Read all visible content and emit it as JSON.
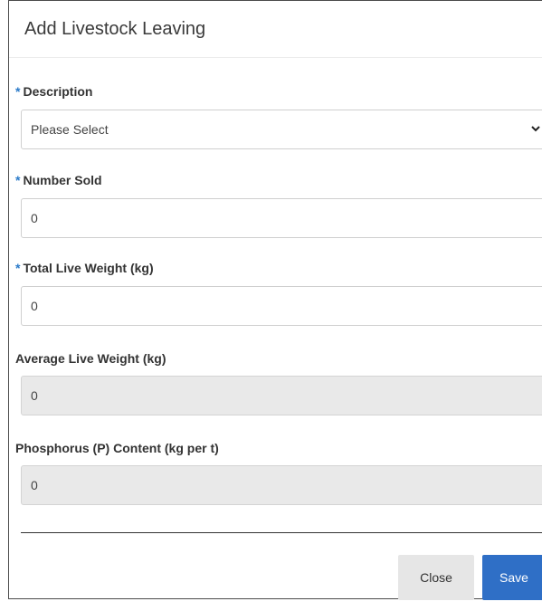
{
  "dialog": {
    "title": "Add Livestock Leaving",
    "required_marker": "*",
    "description": {
      "label": "Description",
      "value": "Please Select"
    },
    "number_sold": {
      "label": "Number Sold",
      "value": "0"
    },
    "total_live_weight": {
      "label": "Total Live Weight (kg)",
      "value": "0"
    },
    "average_live_weight": {
      "label": "Average Live Weight (kg)",
      "value": "0"
    },
    "phosphorus_content": {
      "label": "Phosphorus (P) Content (kg per t)",
      "value": "0"
    },
    "buttons": {
      "close": "Close",
      "save": "Save"
    }
  },
  "colors": {
    "required": "#2a7ac9",
    "save_button": "#2f6fc6",
    "disabled_input": "#e9e9e9"
  },
  "icons": {
    "select_arrow": "chevron-down-icon"
  }
}
